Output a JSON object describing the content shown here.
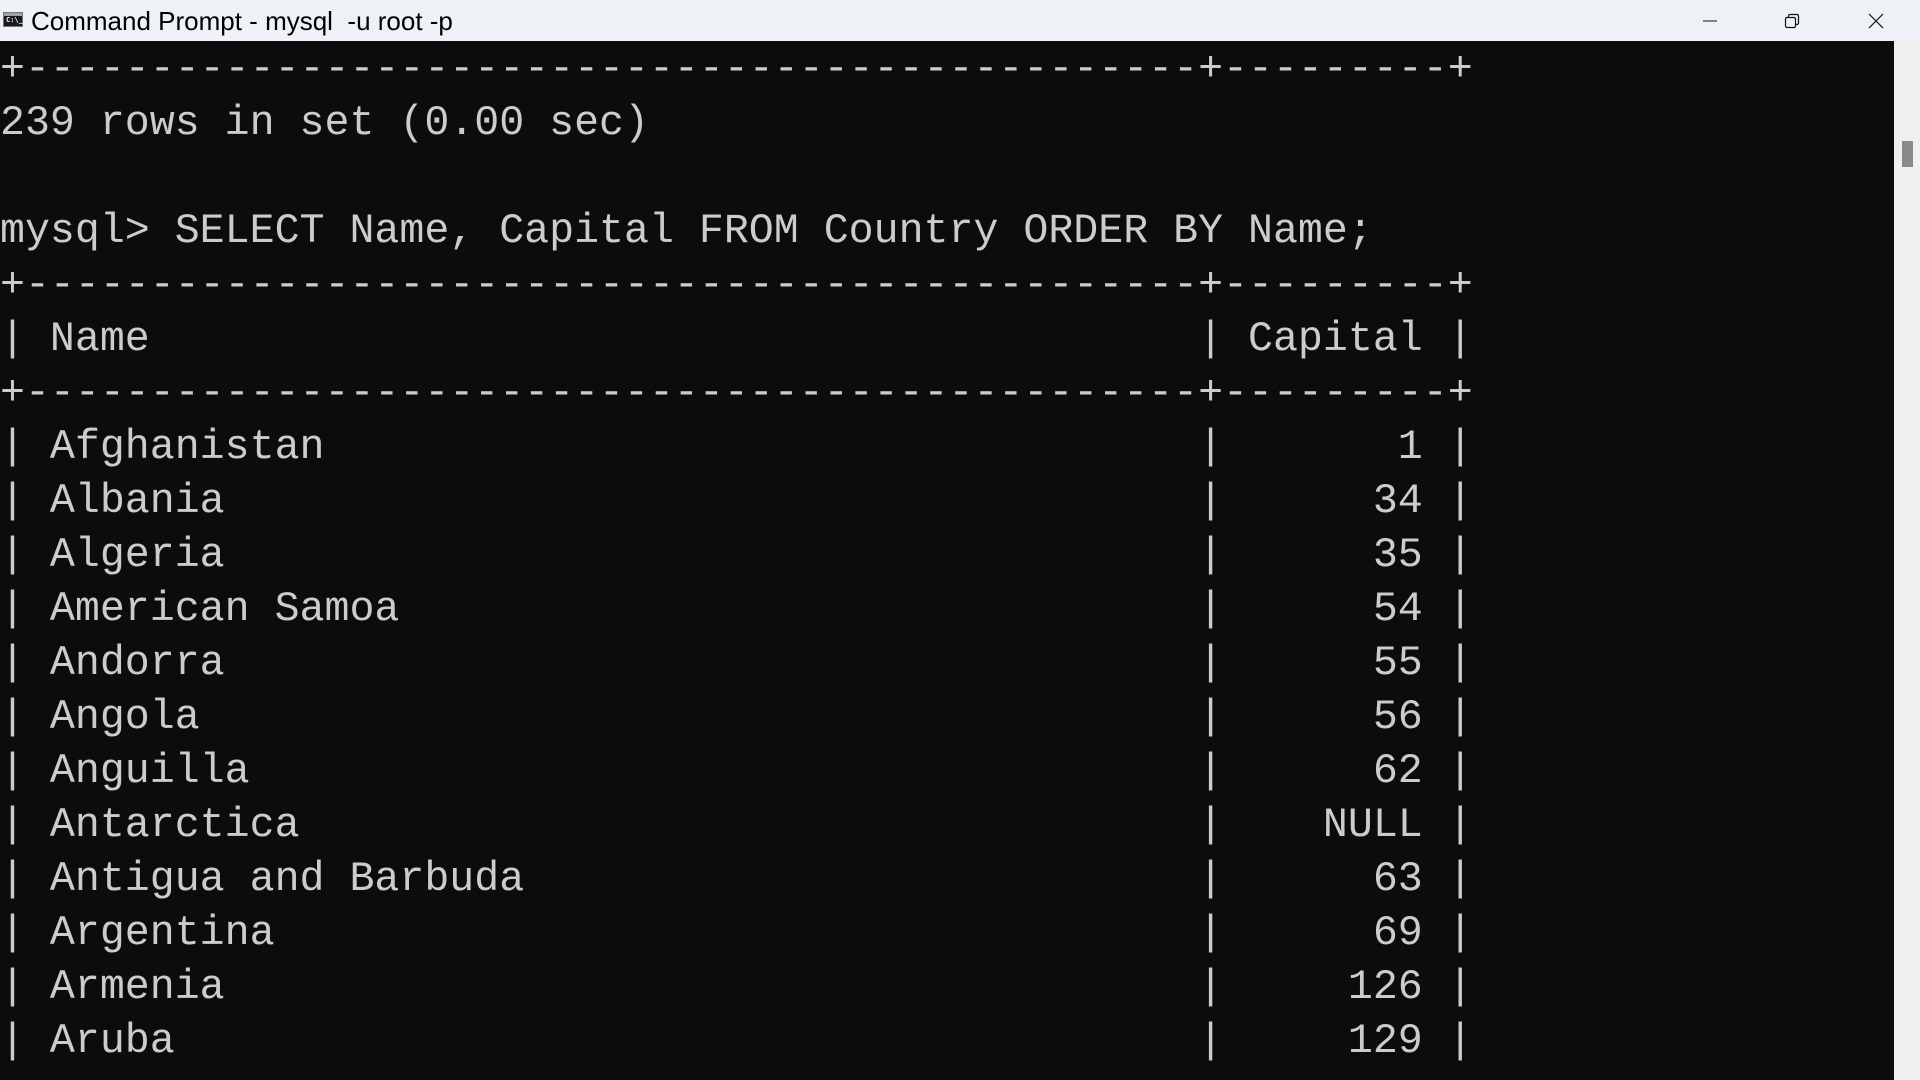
{
  "window": {
    "title": "Command Prompt - mysql  -u root -p",
    "icon": "cmd-icon",
    "icon_text": "C:\\_",
    "controls": {
      "minimize": "minimize-icon",
      "maximize": "restore-icon",
      "close": "close-icon"
    }
  },
  "terminal": {
    "colors": {
      "background": "#0c0c0c",
      "foreground": "#cccccc"
    },
    "border_line": "+-----------------------------------------------+---------+",
    "previous_result_summary": "239 rows in set (0.00 sec)",
    "prompt": "mysql>",
    "command": "SELECT Name, Capital FROM Country ORDER BY Name;",
    "table": {
      "columns": [
        "Name",
        "Capital"
      ],
      "rows": [
        [
          "Afghanistan",
          "1"
        ],
        [
          "Albania",
          "34"
        ],
        [
          "Algeria",
          "35"
        ],
        [
          "American Samoa",
          "54"
        ],
        [
          "Andorra",
          "55"
        ],
        [
          "Angola",
          "56"
        ],
        [
          "Anguilla",
          "62"
        ],
        [
          "Antarctica",
          "NULL"
        ],
        [
          "Antigua and Barbuda",
          "63"
        ],
        [
          "Argentina",
          "69"
        ],
        [
          "Armenia",
          "126"
        ],
        [
          "Aruba",
          "129"
        ]
      ]
    }
  }
}
